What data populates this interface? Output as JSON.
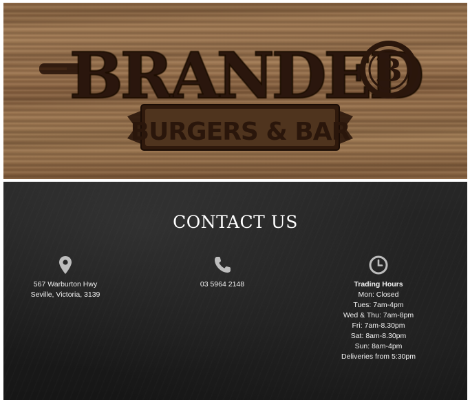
{
  "banner": {
    "logo_name": "BRANDED",
    "logo_badge": "B",
    "tagline": "BURGERS & BAR",
    "colors": {
      "wood": "#9a7450",
      "burn": "#2a160b"
    }
  },
  "contact": {
    "title": "CONTACT US",
    "address": {
      "icon": "map-pin-icon",
      "line1": "567 Warburton Hwy",
      "line2": "Seville, Victoria, 3139"
    },
    "phone": {
      "icon": "phone-icon",
      "number": "03 5964 2148"
    },
    "hours": {
      "icon": "clock-icon",
      "title": "Trading Hours",
      "lines": [
        "Mon: Closed",
        "Tues: 7am-4pm",
        "Wed & Thu: 7am-8pm",
        "Fri: 7am-8.30pm",
        "Sat: 8am-8.30pm",
        "Sun: 8am-4pm",
        "Deliveries from 5:30pm"
      ]
    },
    "colors": {
      "background": "#1f1f1f",
      "text": "#ffffff",
      "icon": "#bdbdbd"
    }
  }
}
